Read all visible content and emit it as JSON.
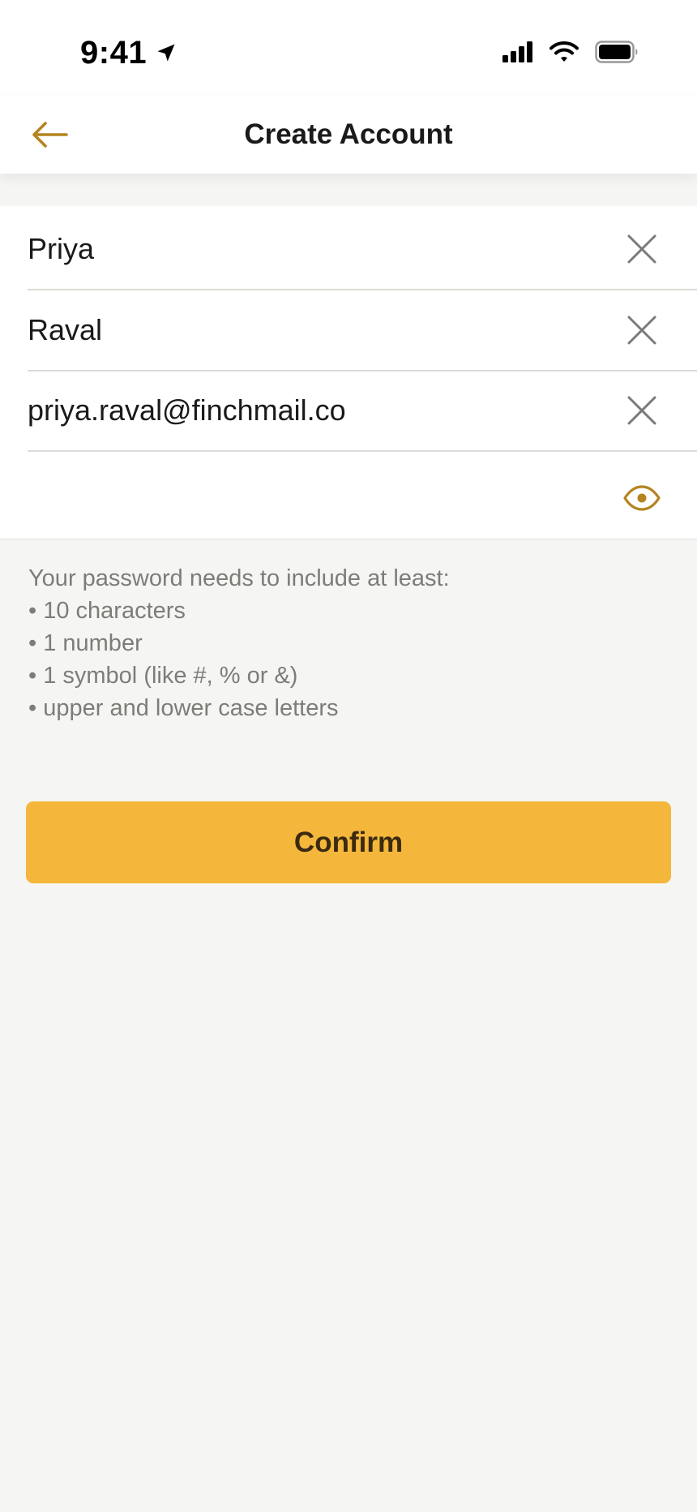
{
  "status_bar": {
    "time": "9:41",
    "icons": [
      "location-arrow-icon",
      "cellular-signal-icon",
      "wifi-icon",
      "battery-icon"
    ]
  },
  "header": {
    "title": "Create Account",
    "back_icon": "arrow-left-icon"
  },
  "form": {
    "first_name": {
      "value": "Priya",
      "action_icon": "close-icon"
    },
    "last_name": {
      "value": "Raval",
      "action_icon": "close-icon"
    },
    "email": {
      "value": "priya.raval@finchmail.co",
      "action_icon": "close-icon"
    },
    "password": {
      "value": "",
      "action_icon": "eye-icon"
    }
  },
  "password_requirements": {
    "intro": "Your password needs to include at least:",
    "items": [
      "• 10 characters",
      "• 1 number",
      "• 1 symbol (like #, % or &)",
      "• upper and lower case letters"
    ]
  },
  "confirm_button": {
    "label": "Confirm"
  },
  "colors": {
    "accent": "#b58420",
    "button": "#f4b73c",
    "button_text": "#3b2a10",
    "background": "#f5f5f3",
    "muted_text": "#7d7d78",
    "clear_icon": "#7a7a78"
  }
}
